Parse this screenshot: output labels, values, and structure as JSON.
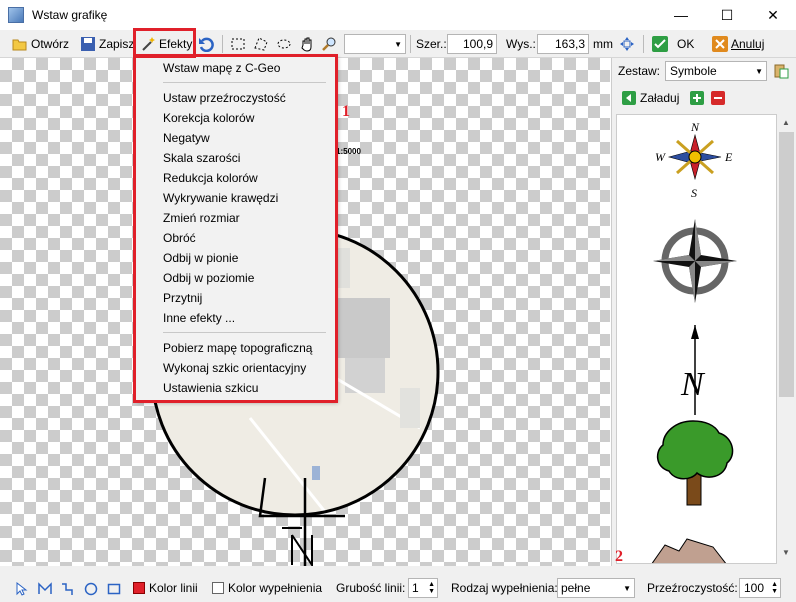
{
  "window": {
    "title": "Wstaw grafikę",
    "minimize_glyph": "—",
    "maximize_glyph": "☐",
    "close_glyph": "✕"
  },
  "toolbar": {
    "open_label": "Otwórz",
    "save_label": "Zapisz",
    "effects_label": "Efekty",
    "width_label": "Szer.:",
    "width_value": "100,9",
    "height_label": "Wys.:",
    "height_value": "163,3",
    "unit": "mm",
    "ok_label": "OK",
    "cancel_label": "Anuluj"
  },
  "effects_menu": {
    "items_group1": [
      "Wstaw mapę z C-Geo"
    ],
    "items_group2": [
      "Ustaw przeźroczystość",
      "Korekcja kolorów",
      "Negatyw",
      "Skala szarości",
      "Redukcja kolorów",
      "Wykrywanie krawędzi",
      "Zmień rozmiar",
      "Obróć",
      "Odbij w pionie",
      "Odbij w poziomie",
      "Przytnij",
      "Inne efekty ..."
    ],
    "items_group3": [
      "Pobierz mapę topograficzną",
      "Wykonaj szkic orientacyjny",
      "Ustawienia szkicu"
    ]
  },
  "canvas": {
    "scale_text": "1:5000"
  },
  "annotations": {
    "menu_marker": "1",
    "bottom_marker": "2"
  },
  "right_panel": {
    "set_label": "Zestaw:",
    "set_value": "Symbole",
    "load_label": "Załaduj",
    "symbols": [
      "compass-rose-color",
      "compass-rose-gray",
      "north-arrow",
      "tree",
      "rock"
    ],
    "compass_n": "N",
    "compass_s": "S",
    "compass_e": "E",
    "compass_w": "W",
    "arrow_n": "N"
  },
  "bottom_bar": {
    "line_color_label": "Kolor linii",
    "fill_color_label": "Kolor wypełnienia",
    "line_width_label": "Grubość linii:",
    "line_width_value": "1",
    "fill_type_label": "Rodzaj wypełnienia:",
    "fill_type_value": "pełne",
    "transparency_label": "Przeźroczystość:",
    "transparency_value": "100"
  },
  "colors": {
    "accent_red": "#e0202a",
    "line_color": "#e0202a",
    "ok_green": "#2e9e44",
    "cancel_orange": "#e08a1e"
  }
}
